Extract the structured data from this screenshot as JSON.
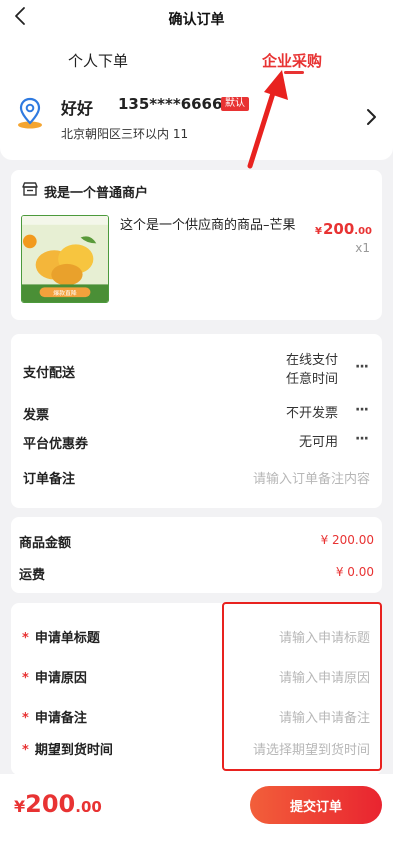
{
  "nav": {
    "title": "确认订单"
  },
  "tabs": {
    "personal": "个人下单",
    "enterprise": "企业采购",
    "active": "enterprise"
  },
  "address": {
    "name": "好好",
    "phone": "135****6666",
    "badge": "默认",
    "detail": "北京朝阳区三环以内 11"
  },
  "shop": {
    "name": "我是一个普通商户",
    "product": {
      "title": "这个是一个供应商的商品–芒果",
      "price_currency": "¥",
      "price_int": "200",
      "price_dec": ".00",
      "qty": "x1",
      "image_text": "爆款直降"
    }
  },
  "options": {
    "payment": {
      "label": "支付配送",
      "value_line1": "在线支付",
      "value_line2": "任意时间"
    },
    "invoice": {
      "label": "发票",
      "value": "不开发票"
    },
    "coupon": {
      "label": "平台优惠券",
      "value": "无可用"
    },
    "remark": {
      "label": "订单备注",
      "placeholder": "请输入订单备注内容"
    },
    "more_glyph": "···"
  },
  "amounts": {
    "goods_label": "商品金额",
    "goods_value": "¥ 200.00",
    "shipping_label": "运费",
    "shipping_value": "¥ 0.00"
  },
  "apply": {
    "required_mark": "*",
    "title": {
      "label": "申请单标题",
      "placeholder": "请输入申请标题"
    },
    "reason": {
      "label": "申请原因",
      "placeholder": "请输入申请原因"
    },
    "remark": {
      "label": "申请备注",
      "placeholder": "请输入申请备注"
    },
    "expected": {
      "label": "期望到货时间",
      "placeholder": "请选择期望到货时间"
    }
  },
  "footer": {
    "currency": "¥",
    "total_int": "200",
    "total_dec": ".00",
    "submit_label": "提交订单"
  },
  "colors": {
    "accent": "#e83333",
    "annotation": "#e8221f",
    "submit_gradient_start": "#f25f3a",
    "submit_gradient_end": "#e92430"
  }
}
